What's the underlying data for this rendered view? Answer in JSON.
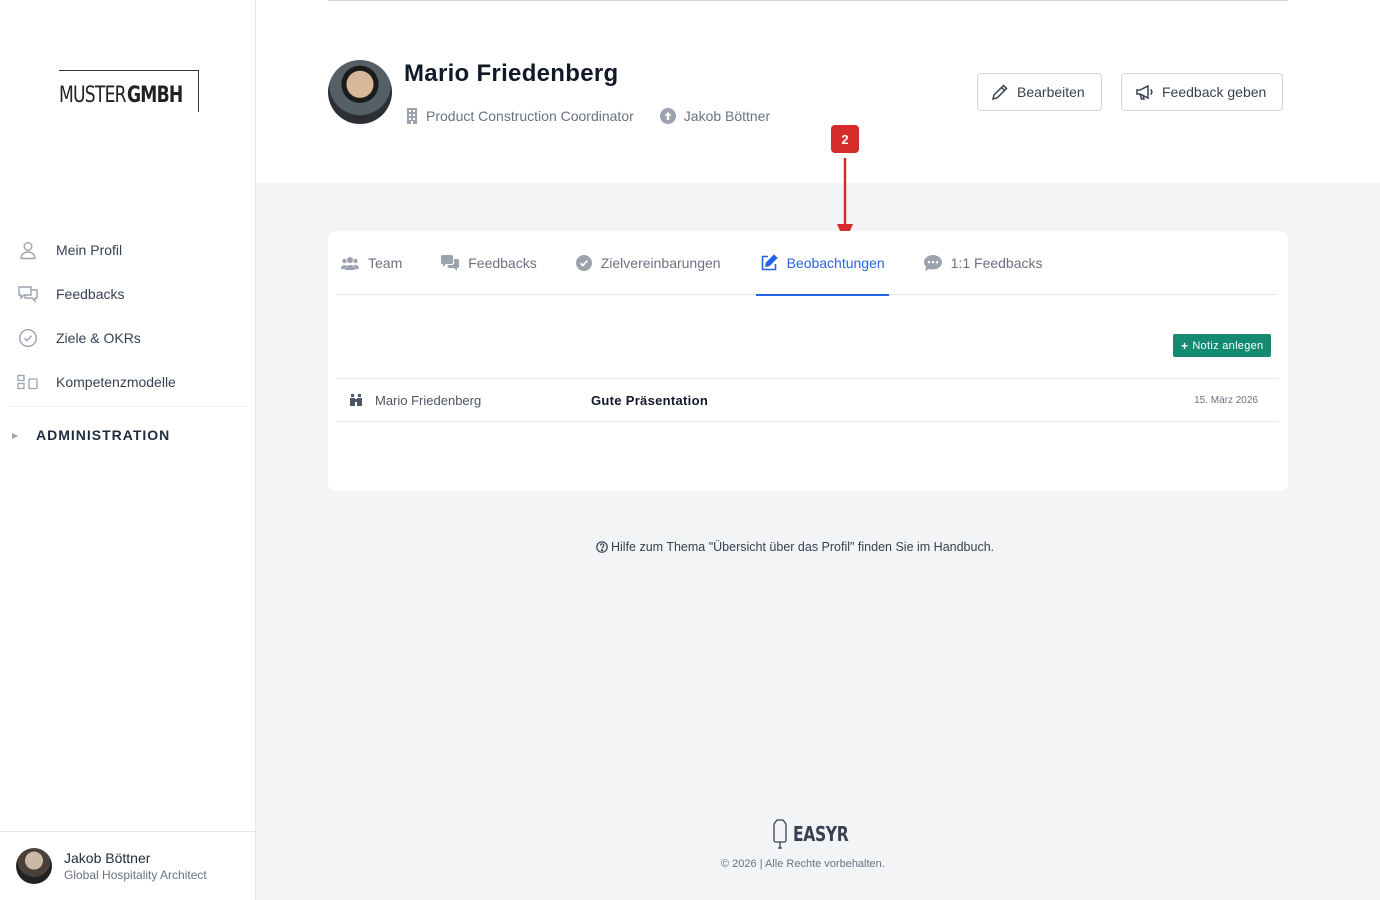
{
  "logo": {
    "part1": "MUSTER",
    "part2": "GMBH"
  },
  "sidebar": {
    "items": [
      {
        "label": "Mein Profil",
        "icon": "user-icon"
      },
      {
        "label": "Feedbacks",
        "icon": "chat-icon"
      },
      {
        "label": "Ziele & OKRs",
        "icon": "check-circle-icon"
      },
      {
        "label": "Kompetenzmodelle",
        "icon": "blocks-icon"
      }
    ],
    "admin_label": "ADMINISTRATION"
  },
  "current_user": {
    "name": "Jakob Böttner",
    "role": "Global Hospitality Architect"
  },
  "profile": {
    "name": "Mario Friedenberg",
    "position": "Product Construction Coordinator",
    "manager": "Jakob Böttner"
  },
  "header_buttons": {
    "edit": "Bearbeiten",
    "feedback": "Feedback geben"
  },
  "marker": {
    "number": "2",
    "color": "#d62b2b"
  },
  "tabs": [
    {
      "label": "Team",
      "icon": "users-icon"
    },
    {
      "label": "Feedbacks",
      "icon": "comments-icon"
    },
    {
      "label": "Zielvereinbarungen",
      "icon": "check-circle-icon"
    },
    {
      "label": "Beobachtungen",
      "icon": "edit-icon",
      "active": true
    },
    {
      "label": "1:1 Feedbacks",
      "icon": "comment-dots-icon"
    }
  ],
  "add_note_label": "Notiz anlegen",
  "notes": [
    {
      "author": "Mario Friedenberg",
      "title": "Gute Präsentation",
      "date": "15. März 2026"
    }
  ],
  "help_text": "Hilfe zum Thema \"Übersicht über das Profil\" finden Sie im Handbuch.",
  "footer": {
    "brand": "EASYR",
    "copyright": "© 2026 | Alle Rechte vorbehalten."
  },
  "colors": {
    "accent": "#2563eb",
    "primary_button": "#148a73",
    "marker": "#d62b2b"
  }
}
